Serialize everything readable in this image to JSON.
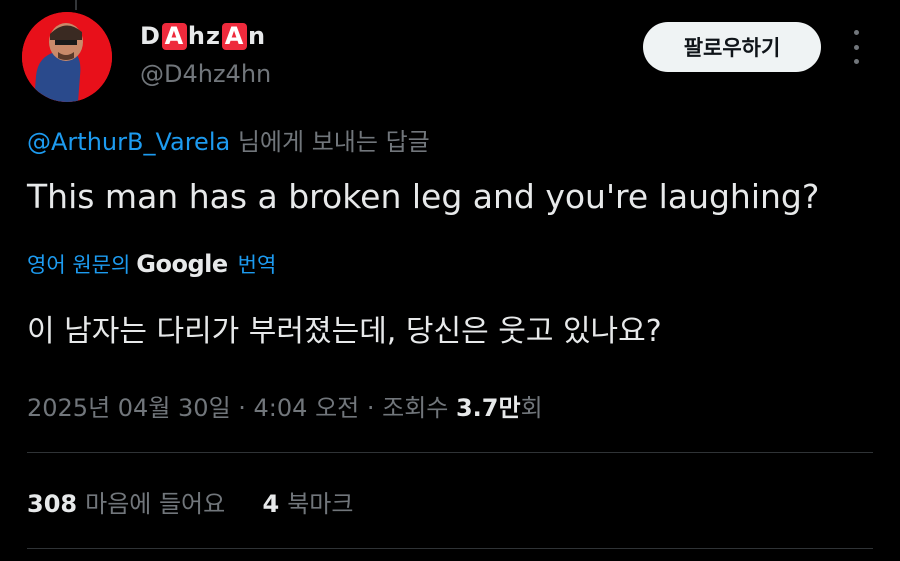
{
  "author": {
    "name_parts": [
      "D",
      "A",
      "hz",
      "A",
      "n"
    ],
    "handle": "@D4hz4hn",
    "follow_label": "팔로우하기"
  },
  "reply_to": {
    "mention": "@ArthurB_Varela",
    "suffix": "님에게 보내는 답글"
  },
  "tweet": {
    "text": "This man has a broken leg and you're laughing?",
    "translation_prefix": "영어 원문의",
    "translation_brand": "Google",
    "translation_suffix": "번역",
    "translated_text": "이 남자는 다리가 부러졌는데, 당신은 웃고 있나요?"
  },
  "meta": {
    "datetime": "2025년 04월 30일 · 4:04 오전 · 조회수 ",
    "views_count": "3.7만",
    "views_suffix": "회"
  },
  "stats": {
    "likes_count": "308",
    "likes_label": "마음에 들어요",
    "bookmarks_count": "4",
    "bookmarks_label": "북마크"
  },
  "colors": {
    "background": "#000000",
    "accent": "#1d9bf0",
    "muted": "#71767b",
    "avatar_bg": "#e8101a",
    "name_box": "#ee2a3c"
  },
  "icons": {
    "more": "more-options-icon",
    "avatar": "avatar-image"
  }
}
